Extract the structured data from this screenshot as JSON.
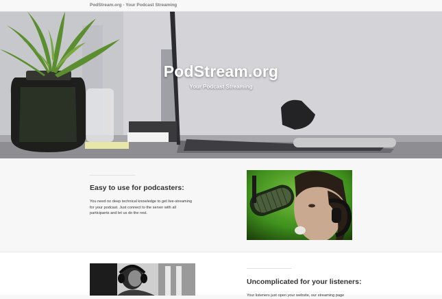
{
  "navbar": {
    "brand": "PodStream.org - Your Podcast Streaming"
  },
  "hero": {
    "title": "PodStream.org",
    "subtitle": "Your Podcast Streaming"
  },
  "features": [
    {
      "heading": "Easy to use for podcasters:",
      "text": "You need no deep technical knowledge to get live-streaming for your podcast. Just connect to the server with all participants and let us do the rest."
    },
    {
      "heading": "Uncomplicated for your listeners:",
      "text": "Your listeners just open your website, our streaming page"
    }
  ],
  "colors": {
    "navbar_bg": "#f8f8f8",
    "brand_text": "#777777",
    "photo_green": "#3f8f1d"
  }
}
